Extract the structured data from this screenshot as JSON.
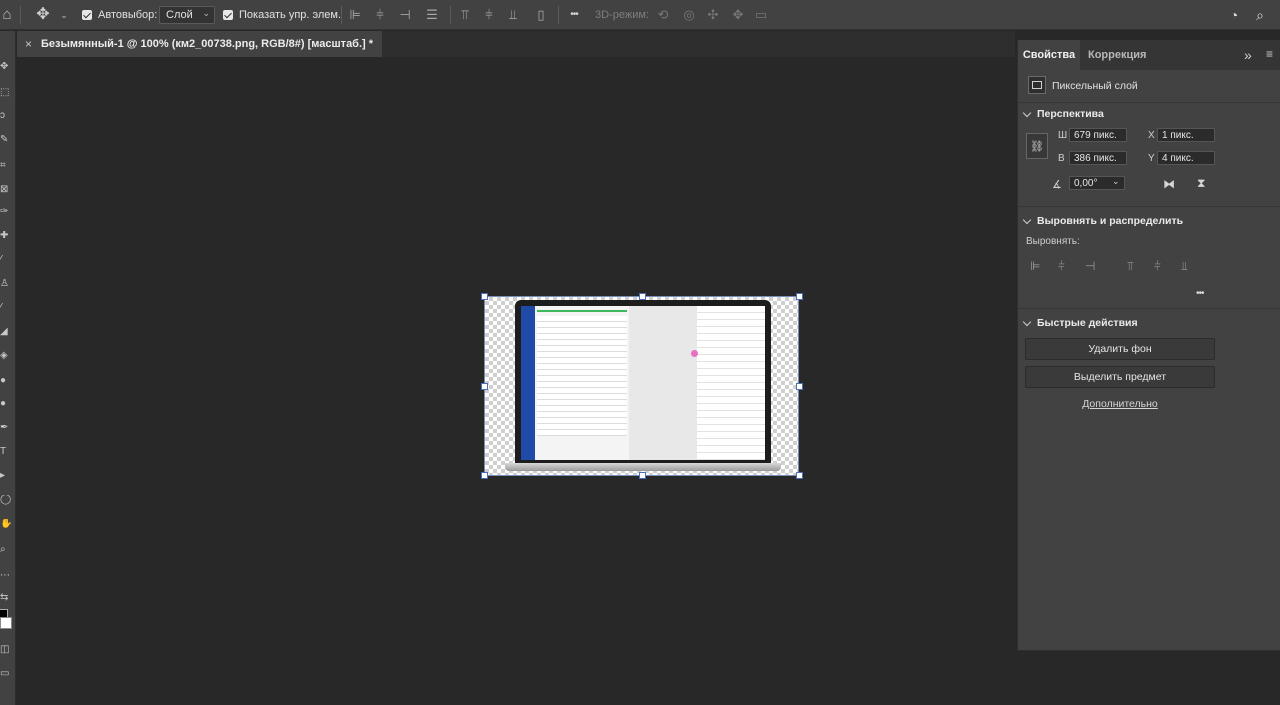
{
  "options": {
    "auto_select_label": "Автовыбор:",
    "auto_select_value": "Слой",
    "show_transform_label": "Показать упр. элем.",
    "more_label": "•••",
    "mode_3d_label": "3D-режим:"
  },
  "document": {
    "tab_close": "×",
    "tab_title": "Безымянный-1 @ 100% (км2_00738.png, RGB/8#) [масштаб.] *"
  },
  "panel": {
    "tab_properties": "Свойства",
    "tab_adjustments": "Коррекция",
    "expand_glyph": "»",
    "layer_type": "Пиксельный слой",
    "perspective": {
      "title": "Перспектива",
      "w_label": "Ш",
      "w_value": "679 пикс.",
      "h_label": "В",
      "h_value": "386 пикс.",
      "x_label": "X",
      "x_value": "1 пикс.",
      "y_label": "Y",
      "y_value": "4 пикс.",
      "angle_value": "0,00°"
    },
    "align": {
      "title": "Выровнять и распределить",
      "label": "Выровнять:",
      "more": "•••"
    },
    "quick": {
      "title": "Быстрые действия",
      "remove_bg": "Удалить фон",
      "select_subject": "Выделить предмет",
      "more_link": "Дополнительно"
    }
  },
  "colors": {
    "app_bg": "#282828",
    "chrome": "#424242",
    "accent_blue": "#4a6fb8"
  }
}
